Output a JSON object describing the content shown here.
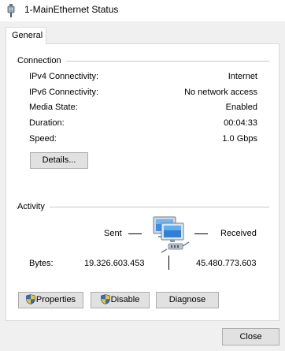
{
  "window": {
    "title": "1-MainEthernet Status",
    "title_icon": "ethernet-cable-icon"
  },
  "tabs": [
    {
      "label": "General",
      "active": true
    }
  ],
  "connection": {
    "group_label": "Connection",
    "rows": [
      {
        "label": "IPv4 Connectivity:",
        "value": "Internet"
      },
      {
        "label": "IPv6 Connectivity:",
        "value": "No network access"
      },
      {
        "label": "Media State:",
        "value": "Enabled"
      },
      {
        "label": "Duration:",
        "value": "00:04:33"
      },
      {
        "label": "Speed:",
        "value": "1.0 Gbps"
      }
    ],
    "details_button": "Details..."
  },
  "activity": {
    "group_label": "Activity",
    "sent_label": "Sent",
    "received_label": "Received",
    "bytes_label": "Bytes:",
    "bytes_sent": "19.326.603.453",
    "bytes_received": "45.480.773.603",
    "network_icon": "network-computers-icon"
  },
  "buttons": {
    "properties": "Properties",
    "disable": "Disable",
    "diagnose": "Diagnose",
    "close": "Close"
  },
  "colors": {
    "window_bg": "#f0f0f0",
    "panel_bg": "#ffffff",
    "button_bg": "#e1e1e1",
    "button_border": "#adadad"
  }
}
